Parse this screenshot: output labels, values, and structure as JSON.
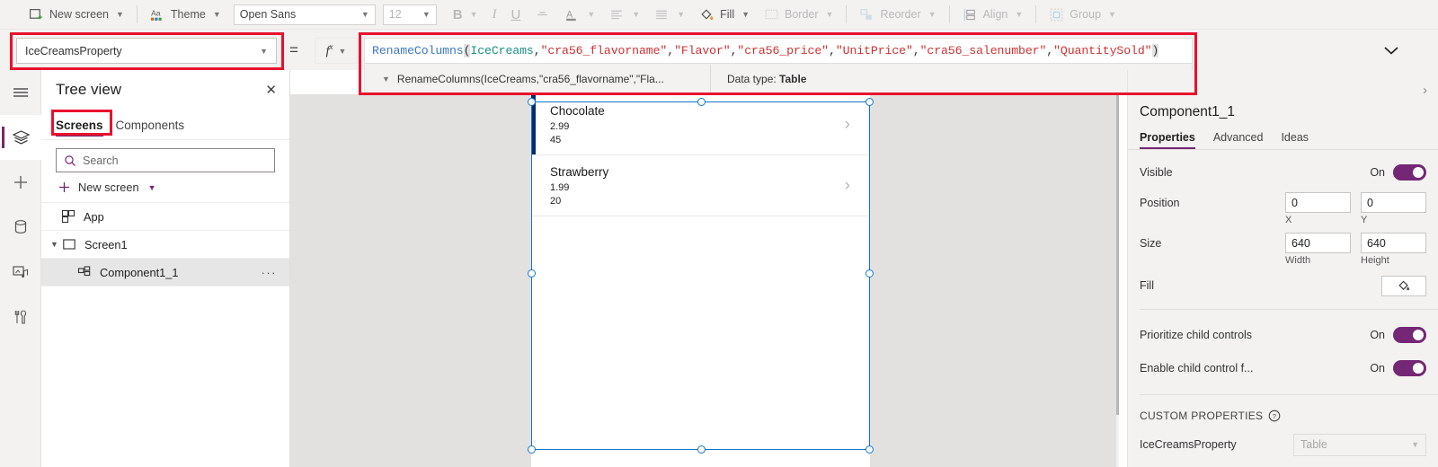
{
  "commandbar": {
    "items": [
      {
        "label": "New screen",
        "icon": "new-screen-icon",
        "caret": true,
        "disabled": false
      },
      {
        "label": "Theme",
        "icon": "theme-icon",
        "caret": true,
        "disabled": false
      },
      {
        "label": "Fill",
        "icon": "fill-bucket-icon",
        "caret": true,
        "disabled": false
      },
      {
        "label": "Border",
        "icon": "border-icon",
        "caret": true,
        "disabled": true
      },
      {
        "label": "Reorder",
        "icon": "reorder-icon",
        "caret": true,
        "disabled": true
      },
      {
        "label": "Align",
        "icon": "align-icon",
        "caret": true,
        "disabled": true
      },
      {
        "label": "Group",
        "icon": "group-icon",
        "caret": true,
        "disabled": true
      }
    ],
    "font_value": "Open Sans",
    "font_size_value": "12",
    "bold_label": "B",
    "italic_label": "I",
    "underline_label": "U",
    "strikethrough_label": "S",
    "font_color_label": "A",
    "paragraph_label": "paragraph-align-icon"
  },
  "formula_bar": {
    "property_selected": "IceCreamsProperty",
    "equals": "=",
    "fx_label": "fx",
    "expand_icon": "chevron-down-icon",
    "formula_plain": "RenameColumns(IceCreams,\"cra56_flavorname\",\"Flavor\",\"cra56_price\",\"UnitPrice\",\"cra56_salenumber\",\"QuantitySold\")",
    "tokens": [
      {
        "t": "RenameColumns",
        "c": "fn"
      },
      {
        "t": "(",
        "c": "pn"
      },
      {
        "t": "IceCreams",
        "c": "id"
      },
      {
        "t": ",",
        "c": "pu"
      },
      {
        "t": "\"cra56_flavorname\"",
        "c": "str"
      },
      {
        "t": ",",
        "c": "pu"
      },
      {
        "t": "\"Flavor\"",
        "c": "str"
      },
      {
        "t": ",",
        "c": "pu"
      },
      {
        "t": "\"cra56_price\"",
        "c": "str"
      },
      {
        "t": ",",
        "c": "pu"
      },
      {
        "t": "\"UnitPrice\"",
        "c": "str"
      },
      {
        "t": ",",
        "c": "pu"
      },
      {
        "t": "\"cra56_salenumber\"",
        "c": "str"
      },
      {
        "t": ",",
        "c": "pu"
      },
      {
        "t": "\"QuantitySold\"",
        "c": "str"
      },
      {
        "t": ")",
        "c": "pn"
      }
    ],
    "intellisense": {
      "signature": "RenameColumns(IceCreams,\"cra56_flavorname\",\"Fla...",
      "expand_icon": "chevron-down-icon",
      "data_type_label": "Data type: ",
      "data_type_value": "Table"
    }
  },
  "rail": {
    "items": [
      {
        "name": "hamburger-menu-icon",
        "active": false
      },
      {
        "name": "tree-view-icon",
        "active": true
      },
      {
        "name": "insert-icon",
        "active": false
      },
      {
        "name": "data-icon",
        "active": false
      },
      {
        "name": "media-icon",
        "active": false
      },
      {
        "name": "advanced-tools-icon",
        "active": false
      }
    ]
  },
  "tree_view": {
    "title": "Tree view",
    "close_icon": "close-icon",
    "tabs": [
      {
        "label": "Screens",
        "selected": true
      },
      {
        "label": "Components",
        "selected": false
      }
    ],
    "search_placeholder": "Search",
    "search_icon": "search-icon",
    "new_screen_label": "New screen",
    "rows": [
      {
        "label": "App",
        "icon": "app-icon",
        "indent": 0,
        "twisty": "",
        "selected": false,
        "dots": false
      },
      {
        "label": "Screen1",
        "icon": "screen-icon",
        "indent": 0,
        "twisty": "v",
        "selected": false,
        "dots": false
      },
      {
        "label": "Component1_1",
        "icon": "component-icon",
        "indent": 1,
        "twisty": "",
        "selected": true,
        "dots": true
      }
    ]
  },
  "canvas": {
    "gallery": [
      {
        "title": "Chocolate",
        "price": "2.99",
        "quantity": "45",
        "selected": true,
        "arrow": "chevron-right-icon"
      },
      {
        "title": "Strawberry",
        "price": "1.99",
        "quantity": "20",
        "selected": false,
        "arrow": "chevron-right-icon"
      }
    ]
  },
  "properties_panel": {
    "collapse_icon": "chevron-right-icon",
    "control_name": "Component1_1",
    "tabs": [
      {
        "label": "Properties",
        "selected": true
      },
      {
        "label": "Advanced",
        "selected": false
      },
      {
        "label": "Ideas",
        "selected": false
      }
    ],
    "visible": {
      "label": "Visible",
      "state": "On"
    },
    "position": {
      "label": "Position",
      "x": "0",
      "y": "0",
      "x_caption": "X",
      "y_caption": "Y"
    },
    "size": {
      "label": "Size",
      "width": "640",
      "height": "640",
      "width_caption": "Width",
      "height_caption": "Height"
    },
    "fill": {
      "label": "Fill",
      "icon": "fill-bucket-icon"
    },
    "prioritize": {
      "label": "Prioritize child controls",
      "state": "On"
    },
    "enable_child": {
      "label": "Enable child control f...",
      "state": "On"
    },
    "custom_properties": {
      "heading": "CUSTOM PROPERTIES",
      "help_icon": "help-circle-icon",
      "rows": [
        {
          "name": "IceCreamsProperty",
          "value": "Table"
        }
      ]
    }
  },
  "annotations": {
    "color": "#e8112d",
    "boxes": [
      "property-selector",
      "formula-bar",
      "screens-tab"
    ]
  }
}
